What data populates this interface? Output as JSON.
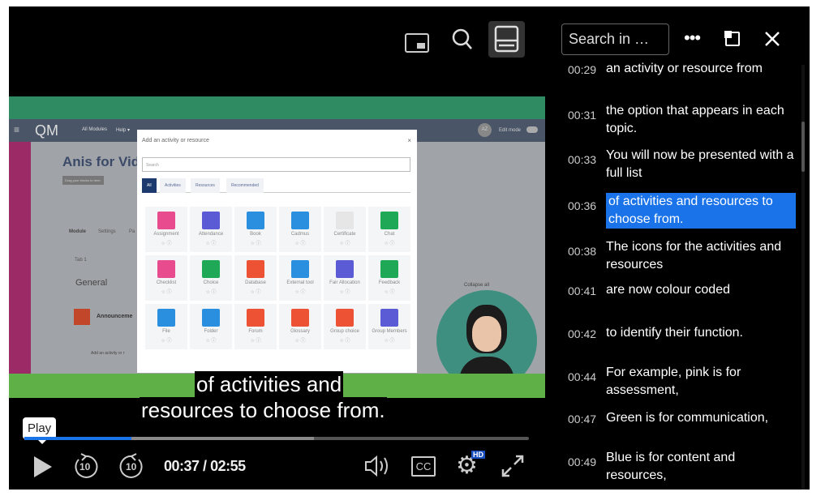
{
  "header": {
    "search_placeholder": "Search in …",
    "icons": [
      "picture-in-picture-icon",
      "search-icon",
      "transcript-icon",
      "more-icon",
      "popout-icon",
      "close-icon"
    ]
  },
  "video": {
    "moodle": {
      "nav": [
        "All Modules",
        "Help ▾"
      ],
      "logo": "QM",
      "avatar": "AZ",
      "edit_mode": "Edit mode",
      "course_title": "Anis for Vide",
      "blocks_btn": "Drag your blocks to here.",
      "tabs": [
        "Module",
        "Settings",
        "Pa"
      ],
      "tab1": "Tab 1",
      "section": "General",
      "collapse": "Collapse all",
      "announcement": "Announceme",
      "add_activity": "Add an activity or r",
      "modal": {
        "title": "Add an activity or resource",
        "search_placeholder": "Search",
        "tabs": [
          "All",
          "Activities",
          "Resources",
          "Recommended"
        ],
        "items": [
          {
            "label": "Assignment",
            "color": "#e94b8f"
          },
          {
            "label": "Attendance",
            "color": "#5b5bd6"
          },
          {
            "label": "Book",
            "color": "#2b8fe0"
          },
          {
            "label": "Cadmus",
            "color": "#2b8fe0"
          },
          {
            "label": "Certificate",
            "color": "#e6e6e6"
          },
          {
            "label": "Chat",
            "color": "#1fa855"
          },
          {
            "label": "Checklist",
            "color": "#e94b8f"
          },
          {
            "label": "Choice",
            "color": "#1fa855"
          },
          {
            "label": "Database",
            "color": "#ee5235"
          },
          {
            "label": "External tool",
            "color": "#2b8fe0"
          },
          {
            "label": "Fair Allocation",
            "color": "#5b5bd6"
          },
          {
            "label": "Feedback",
            "color": "#1fa855"
          },
          {
            "label": "File",
            "color": "#2b8fe0"
          },
          {
            "label": "Folder",
            "color": "#2b8fe0"
          },
          {
            "label": "Forum",
            "color": "#ee5235"
          },
          {
            "label": "Glossary",
            "color": "#ee5235"
          },
          {
            "label": "Group choice",
            "color": "#ee5235"
          },
          {
            "label": "Group Members",
            "color": "#5b5bd6"
          }
        ]
      }
    },
    "subtitle": [
      "of activities and",
      "resources to choose from."
    ]
  },
  "controls": {
    "tooltip": "Play",
    "progress_played_pct": 21.2,
    "progress_buffered_pct": 57.4,
    "current_time": "00:37",
    "separator": " / ",
    "duration": "02:55",
    "hd_badge": "HD",
    "cc_label": "CC",
    "rewind_label": "10",
    "forward_label": "10",
    "accent": "#1a73e8"
  },
  "transcript": [
    {
      "time": "00:29",
      "text": "an activity or resource from"
    },
    {
      "time": "00:31",
      "text": "the option that appears in each topic."
    },
    {
      "time": "00:33",
      "text": "You will now be presented with a full list"
    },
    {
      "time": "00:36",
      "text": "of activities and resources to choose from.",
      "active": true
    },
    {
      "time": "00:38",
      "text": "The icons for the activities and resources"
    },
    {
      "time": "00:41",
      "text": "are now colour coded"
    },
    {
      "time": "00:42",
      "text": "to identify their function."
    },
    {
      "time": "00:44",
      "text": "For example, pink is for assessment,"
    },
    {
      "time": "00:47",
      "text": "Green is for communication,"
    },
    {
      "time": "00:49",
      "text": "Blue is for content and resources,"
    }
  ]
}
